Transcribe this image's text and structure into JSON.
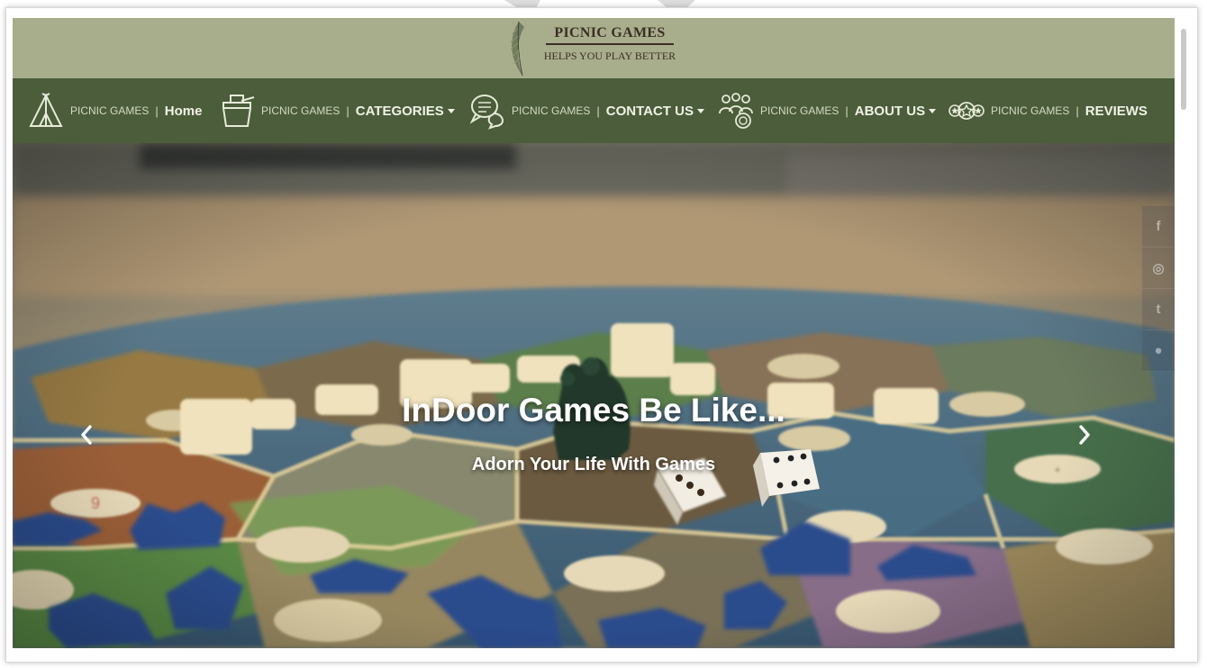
{
  "logo": {
    "title": "PICNIC GAMES",
    "subtitle": "HELPS YOU PLAY BETTER"
  },
  "nav": {
    "items": [
      {
        "brand": "PICNIC GAMES",
        "separator": "|",
        "label": "Home",
        "icon": "tent-icon",
        "dropdown": false
      },
      {
        "brand": "PICNIC GAMES",
        "separator": "|",
        "label": "CATEGORIES",
        "icon": "picnic-basket-icon",
        "dropdown": true
      },
      {
        "brand": "PICNIC GAMES",
        "separator": "|",
        "label": "CONTACT US",
        "icon": "chat-bubbles-icon",
        "dropdown": true
      },
      {
        "brand": "PICNIC GAMES",
        "separator": "|",
        "label": "ABOUT US",
        "icon": "group-icon",
        "dropdown": true
      },
      {
        "brand": "PICNIC GAMES",
        "separator": "|",
        "label": "REVIEWS",
        "icon": "stars-rating-icon",
        "dropdown": false
      }
    ]
  },
  "hero": {
    "title": "InDoor Games Be Like...",
    "subtitle": "Adorn Your Life With Games",
    "prev_icon": "chevron-left-icon",
    "next_icon": "chevron-right-icon"
  },
  "social": {
    "items": [
      {
        "glyph": "f",
        "icon": "facebook-icon"
      },
      {
        "glyph": "◎",
        "icon": "instagram-icon"
      },
      {
        "glyph": "t",
        "icon": "twitter-icon"
      },
      {
        "glyph": "●",
        "icon": "pinterest-icon"
      }
    ]
  },
  "colors": {
    "logo_bar": "#a8ae8c",
    "nav_bar": "#4b5d3a",
    "text_light": "#f0f2e6"
  }
}
